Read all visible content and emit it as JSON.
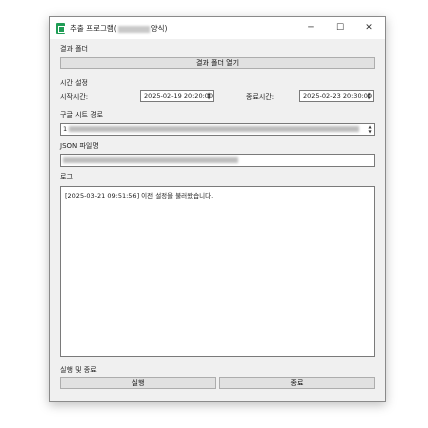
{
  "window": {
    "title_prefix": "추출 프로그램(",
    "title_suffix": "양식)",
    "minimize_icon": "minimize-icon",
    "maximize_icon": "maximize-icon",
    "close_icon": "close-icon",
    "accent": "#1f9d55"
  },
  "result_folder": {
    "section_label": "결과 폴더",
    "open_button": "결과 폴더 열기"
  },
  "time_settings": {
    "section_label": "시간 설정",
    "start_label": "시작시간:",
    "start_value": "2025-02-19 20:20:00",
    "end_label": "종료시간:",
    "end_value": "2025-02-23 20:30:00"
  },
  "sheet_path": {
    "section_label": "구글 시트 경로",
    "value_prefix": "1"
  },
  "json_file": {
    "section_label": "JSON 파일명"
  },
  "log": {
    "section_label": "로그",
    "lines": [
      "[2025-03-21 09:51:56] 이전 설정을 불러왔습니다."
    ]
  },
  "run": {
    "section_label": "실행 및 종료",
    "run_button": "실행",
    "exit_button": "종료"
  }
}
